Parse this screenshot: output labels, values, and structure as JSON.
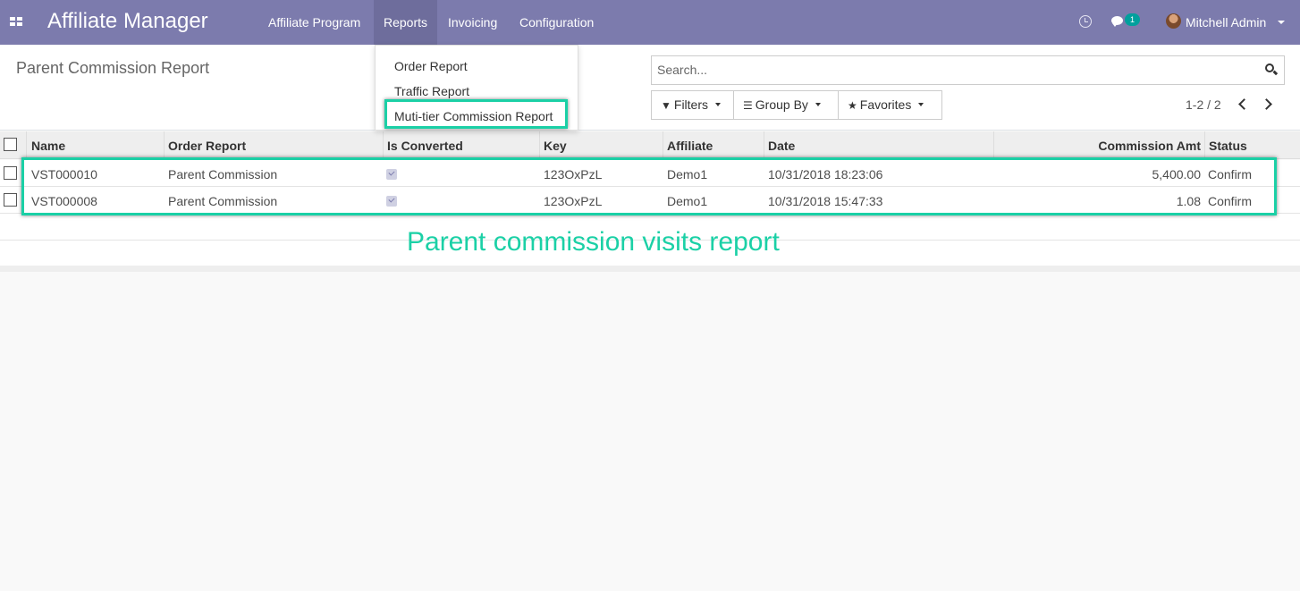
{
  "navbar": {
    "app_title": "Affiliate Manager",
    "menus": [
      "Affiliate Program",
      "Reports",
      "Invoicing",
      "Configuration"
    ],
    "active_menu": "Reports",
    "chat_count": "1",
    "user_name": "Mitchell Admin",
    "bg_color": "#7c7bad"
  },
  "control_panel": {
    "breadcrumb": "Parent Commission Report",
    "search_placeholder": "Search...",
    "filters_label": "Filters",
    "groupby_label": "Group By",
    "favorites_label": "Favorites",
    "pager": "1-2 / 2"
  },
  "dropdown": {
    "items": [
      "Order Report",
      "Traffic Report",
      "Muti-tier Commission Report"
    ],
    "highlighted": "Muti-tier Commission Report"
  },
  "table": {
    "columns": [
      "Name",
      "Order Report",
      "Is Converted",
      "Key",
      "Affiliate",
      "Date",
      "Commission Amt",
      "Status"
    ],
    "rows": [
      {
        "name": "VST000010",
        "order_report": "Parent Commission",
        "is_converted": true,
        "key": "123OxPzL",
        "affiliate": "Demo1",
        "date": "10/31/2018 18:23:06",
        "commission_amt": "5,400.00",
        "status": "Confirm"
      },
      {
        "name": "VST000008",
        "order_report": "Parent Commission",
        "is_converted": true,
        "key": "123OxPzL",
        "affiliate": "Demo1",
        "date": "10/31/2018 15:47:33",
        "commission_amt": "1.08",
        "status": "Confirm"
      }
    ]
  },
  "annotation": {
    "text": "Parent commission visits report",
    "color": "#1bd0a6"
  }
}
